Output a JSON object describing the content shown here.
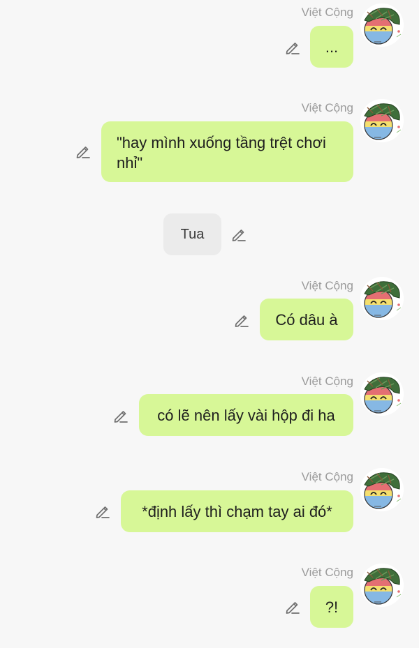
{
  "messages": [
    {
      "sender": "Việt Cộng",
      "text": "..."
    },
    {
      "sender": "Việt Cộng",
      "text": "\"hay mình xuống tầng trệt chơi nhỉ\""
    },
    {
      "sender": "",
      "text": "Tua"
    },
    {
      "sender": "Việt Cộng",
      "text": "Có dâu à"
    },
    {
      "sender": "Việt Cộng",
      "text": "có lẽ nên lấy vài hộp đi ha"
    },
    {
      "sender": "Việt Cộng",
      "text": "*định lấy thì chạm tay ai đó*"
    },
    {
      "sender": "Việt Cộng",
      "text": "?!"
    }
  ],
  "colors": {
    "background": "#f7f7f7",
    "bubble_outgoing": "#d7f797",
    "bubble_narration": "#ebebeb",
    "sender_name": "#9a9a9a",
    "icon": "#6f6f6f"
  },
  "icons": {
    "edit": "pencil-icon",
    "avatar": "countryball-avatar"
  }
}
